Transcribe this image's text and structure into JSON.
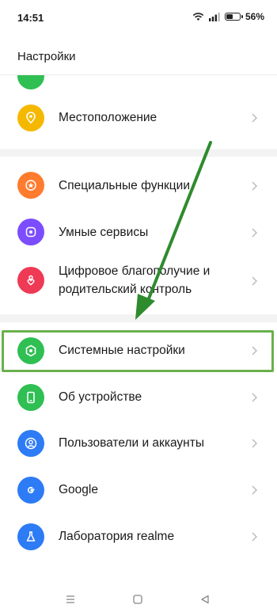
{
  "status": {
    "time": "14:51",
    "battery": "56%",
    "battery_level": 0.56
  },
  "header": {
    "title": "Настройки"
  },
  "items": [
    {
      "label": "Местоположение",
      "icon": "location-icon",
      "color": "#f5b800"
    },
    {
      "label": "Специальные функции",
      "icon": "star-icon",
      "color": "#ff7b2e"
    },
    {
      "label": "Умные сервисы",
      "icon": "smart-services-icon",
      "color": "#7c4dff"
    },
    {
      "label": "Цифровое благополучие и\nродительский контроль",
      "icon": "heart-person-icon",
      "color": "#ef3a55"
    },
    {
      "label": "Системные настройки",
      "icon": "hexagon-icon",
      "color": "#2fbf53"
    },
    {
      "label": "Об устройстве",
      "icon": "phone-icon",
      "color": "#2fbf53"
    },
    {
      "label": "Пользователи и аккаунты",
      "icon": "user-icon",
      "color": "#2d7bf5"
    },
    {
      "label": "Google",
      "icon": "google-icon",
      "color": "#2d7bf5"
    },
    {
      "label": "Лаборатория realme",
      "icon": "flask-icon",
      "color": "#2d7bf5"
    }
  ],
  "colors": {
    "highlight": "#6ab04c",
    "arrow": "#2e8b2e"
  }
}
